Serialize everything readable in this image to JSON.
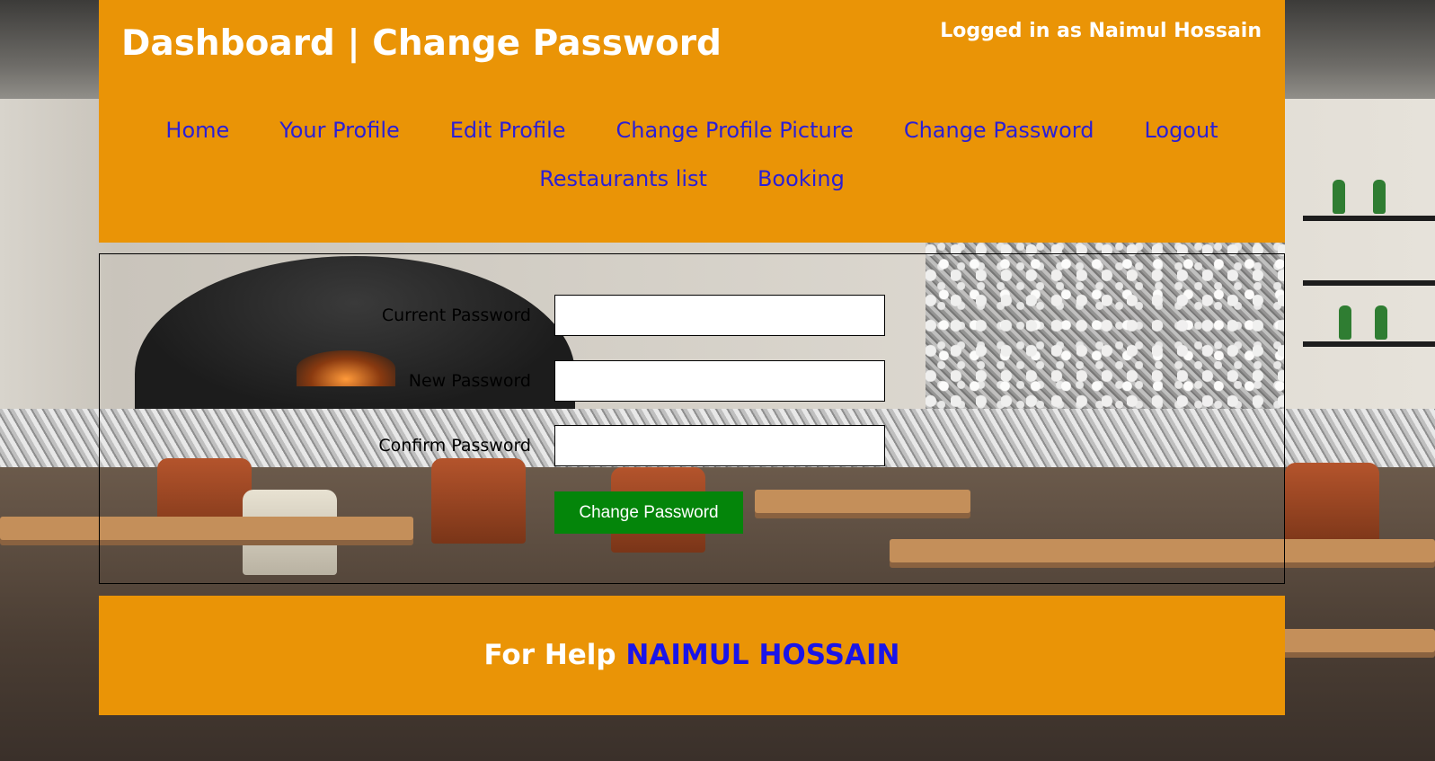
{
  "header": {
    "title": "Dashboard | Change Password",
    "logged_in": "Logged in as Naimul Hossain"
  },
  "nav": {
    "items": [
      {
        "label": "Home"
      },
      {
        "label": "Your Profile"
      },
      {
        "label": "Edit Profile"
      },
      {
        "label": "Change Profile Picture"
      },
      {
        "label": "Change Password"
      },
      {
        "label": "Logout"
      },
      {
        "label": "Restaurants list"
      },
      {
        "label": "Booking"
      }
    ]
  },
  "form": {
    "current_password_label": "Current Password",
    "current_password_value": "",
    "new_password_label": "New Password",
    "new_password_value": "",
    "confirm_password_label": "Confirm Password",
    "confirm_password_value": "",
    "submit_label": "Change Password"
  },
  "footer": {
    "help_prefix": "For Help",
    "help_name": "NAIMUL HOSSAIN"
  },
  "colors": {
    "header_bg": "#ea9406",
    "nav_link": "#2b1fd6",
    "submit_bg": "#04850a",
    "footer_name": "#1a14e8"
  }
}
